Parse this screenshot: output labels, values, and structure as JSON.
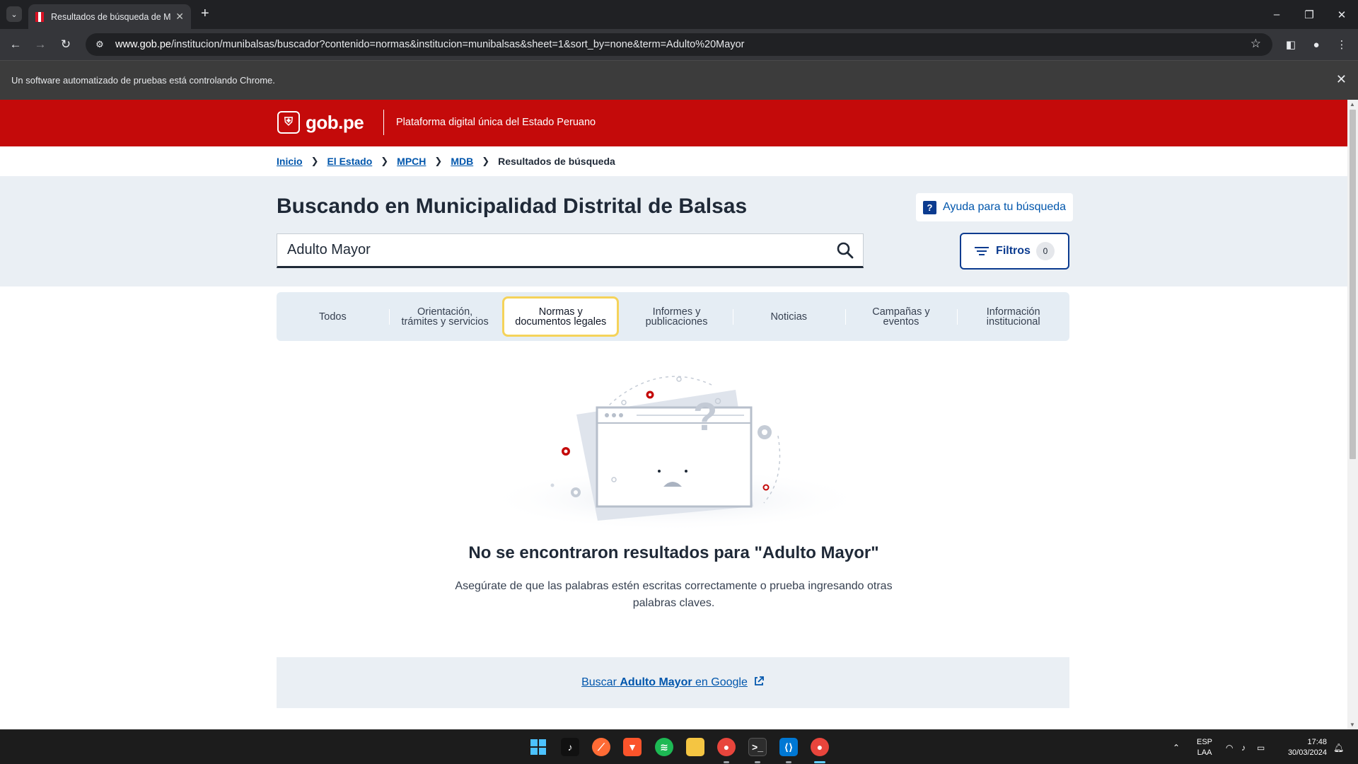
{
  "browser": {
    "tab_title": "Resultados de búsqueda de M",
    "url_host": "www.gob.pe",
    "url_path": "/institucion/munibalsas/buscador?contenido=normas&institucion=munibalsas&sheet=1&sort_by=none&term=Adulto%20Mayor",
    "infobar_text": "Un software automatizado de pruebas está controlando Chrome."
  },
  "header": {
    "logo_text": "gob.pe",
    "tagline": "Plataforma digital única del Estado Peruano"
  },
  "breadcrumb": {
    "items": [
      "Inicio",
      "El Estado",
      "MPCH",
      "MDB"
    ],
    "current": "Resultados de búsqueda"
  },
  "search": {
    "title": "Buscando en Municipalidad Distrital de Balsas",
    "help_label": "Ayuda para tu búsqueda",
    "query": "Adulto Mayor",
    "filters_label": "Filtros",
    "filters_count": "0"
  },
  "tabs": [
    {
      "line1": "Todos",
      "line2": ""
    },
    {
      "line1": "Orientación,",
      "line2": "trámites y servicios"
    },
    {
      "line1": "Normas y",
      "line2": "documentos legales"
    },
    {
      "line1": "Informes y",
      "line2": "publicaciones"
    },
    {
      "line1": "Noticias",
      "line2": ""
    },
    {
      "line1": "Campañas y",
      "line2": "eventos"
    },
    {
      "line1": "Información",
      "line2": "institucional"
    }
  ],
  "empty_state": {
    "title": "No se encontraron resultados para \"Adulto Mayor\"",
    "description": "Asegúrate de que las palabras estén escritas correctamente o prueba ingresando otras palabras claves."
  },
  "google_search": {
    "prefix": "Buscar",
    "term": "Adulto Mayor",
    "suffix": "en Google"
  },
  "taskbar": {
    "lang_line1": "ESP",
    "lang_line2": "LAA",
    "time": "17:48",
    "date": "30/03/2024"
  },
  "colors": {
    "brand_red": "#c40a0a",
    "link_blue": "#0056ac",
    "active_tab_border": "#f5d35a"
  }
}
